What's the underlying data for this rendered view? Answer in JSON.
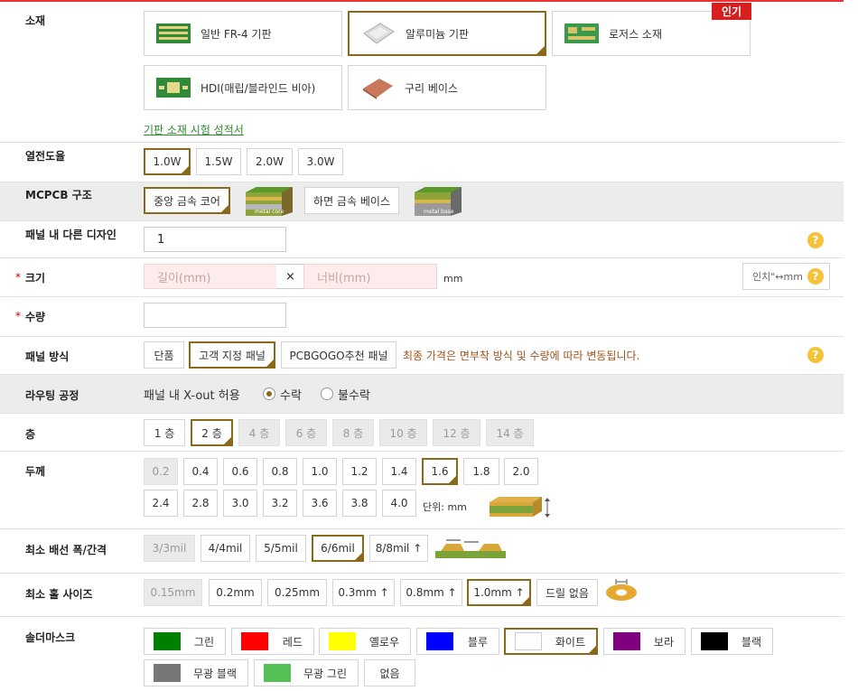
{
  "material": {
    "label": "소재",
    "options": [
      "일반 FR-4 기판",
      "알루미늄 기판",
      "로저스 소재",
      "HDI(매립/블라인드 비아)",
      "구리 베이스"
    ],
    "popular_badge": "인기",
    "report_link": "기판 소재 시험 성적서",
    "selected": "알루미늄 기판"
  },
  "thermal": {
    "label": "열전도율",
    "options": [
      "1.0W",
      "1.5W",
      "2.0W",
      "3.0W"
    ],
    "selected": "1.0W"
  },
  "mcpcb": {
    "label": "MCPCB 구조",
    "options": [
      "중앙 금속 코어",
      "하면 금속 베이스"
    ],
    "img_core": "metal core",
    "img_base": "metal base",
    "selected": "중앙 금속 코어"
  },
  "designs": {
    "label": "패널 내 다른 디자인",
    "value": "1"
  },
  "size": {
    "label": "크기",
    "length_placeholder": "길이(mm)",
    "width_placeholder": "너비(mm)",
    "separator": "×",
    "unit": "mm",
    "convert_button": "인치\"↔mm"
  },
  "quantity": {
    "label": "수량",
    "value": ""
  },
  "panel": {
    "label": "패널 방식",
    "options": [
      "단품",
      "고객 지정 패널",
      "PCBGOGO추천 패널"
    ],
    "selected": "고객 지정 패널",
    "note": "최종 가격은 면부착 방식 및 수량에 따라 변동됩니다."
  },
  "routing": {
    "label": "라우팅 공정",
    "question": "패널 내 X-out 허용",
    "accept": "수락",
    "reject": "불수락",
    "selected": "수락"
  },
  "layers": {
    "label": "층",
    "options": [
      "1 층",
      "2 층",
      "4 층",
      "6 층",
      "8 층",
      "10 층",
      "12 층",
      "14 층"
    ],
    "selected": "2 층"
  },
  "thickness": {
    "label": "두께",
    "options": [
      "0.2",
      "0.4",
      "0.6",
      "0.8",
      "1.0",
      "1.2",
      "1.4",
      "1.6",
      "1.8",
      "2.0",
      "2.4",
      "2.8",
      "3.0",
      "3.2",
      "3.6",
      "3.8",
      "4.0"
    ],
    "selected": "1.6",
    "unit_note": "단위: mm"
  },
  "trace": {
    "label": "최소 배선 폭/간격",
    "options": [
      "3/3mil",
      "4/4mil",
      "5/5mil",
      "6/6mil",
      "8/8mil ↑"
    ],
    "selected": "6/6mil"
  },
  "hole": {
    "label": "최소 홀 사이즈",
    "options": [
      "0.15mm",
      "0.2mm",
      "0.25mm",
      "0.3mm ↑",
      "0.8mm ↑",
      "1.0mm ↑",
      "드릴 없음"
    ],
    "selected": "1.0mm ↑"
  },
  "soldermask": {
    "label": "솔더마스크",
    "options": [
      {
        "name": "그린",
        "color": "#008000"
      },
      {
        "name": "레드",
        "color": "#ff0000"
      },
      {
        "name": "옐로우",
        "color": "#ffff00"
      },
      {
        "name": "블루",
        "color": "#0000ff"
      },
      {
        "name": "화이트",
        "color": "#ffffff"
      },
      {
        "name": "보라",
        "color": "#800080"
      },
      {
        "name": "블랙",
        "color": "#000000"
      },
      {
        "name": "무광 블랙",
        "color": "#777777"
      },
      {
        "name": "무광 그린",
        "color": "#55c055"
      },
      {
        "name": "없음",
        "color": ""
      }
    ],
    "selected": "화이트"
  },
  "colors": {
    "accent": "#8a6a1a",
    "required": "#cc0000",
    "help": "#f6c23a",
    "note": "#a0521a",
    "link": "#2f8a2f"
  }
}
